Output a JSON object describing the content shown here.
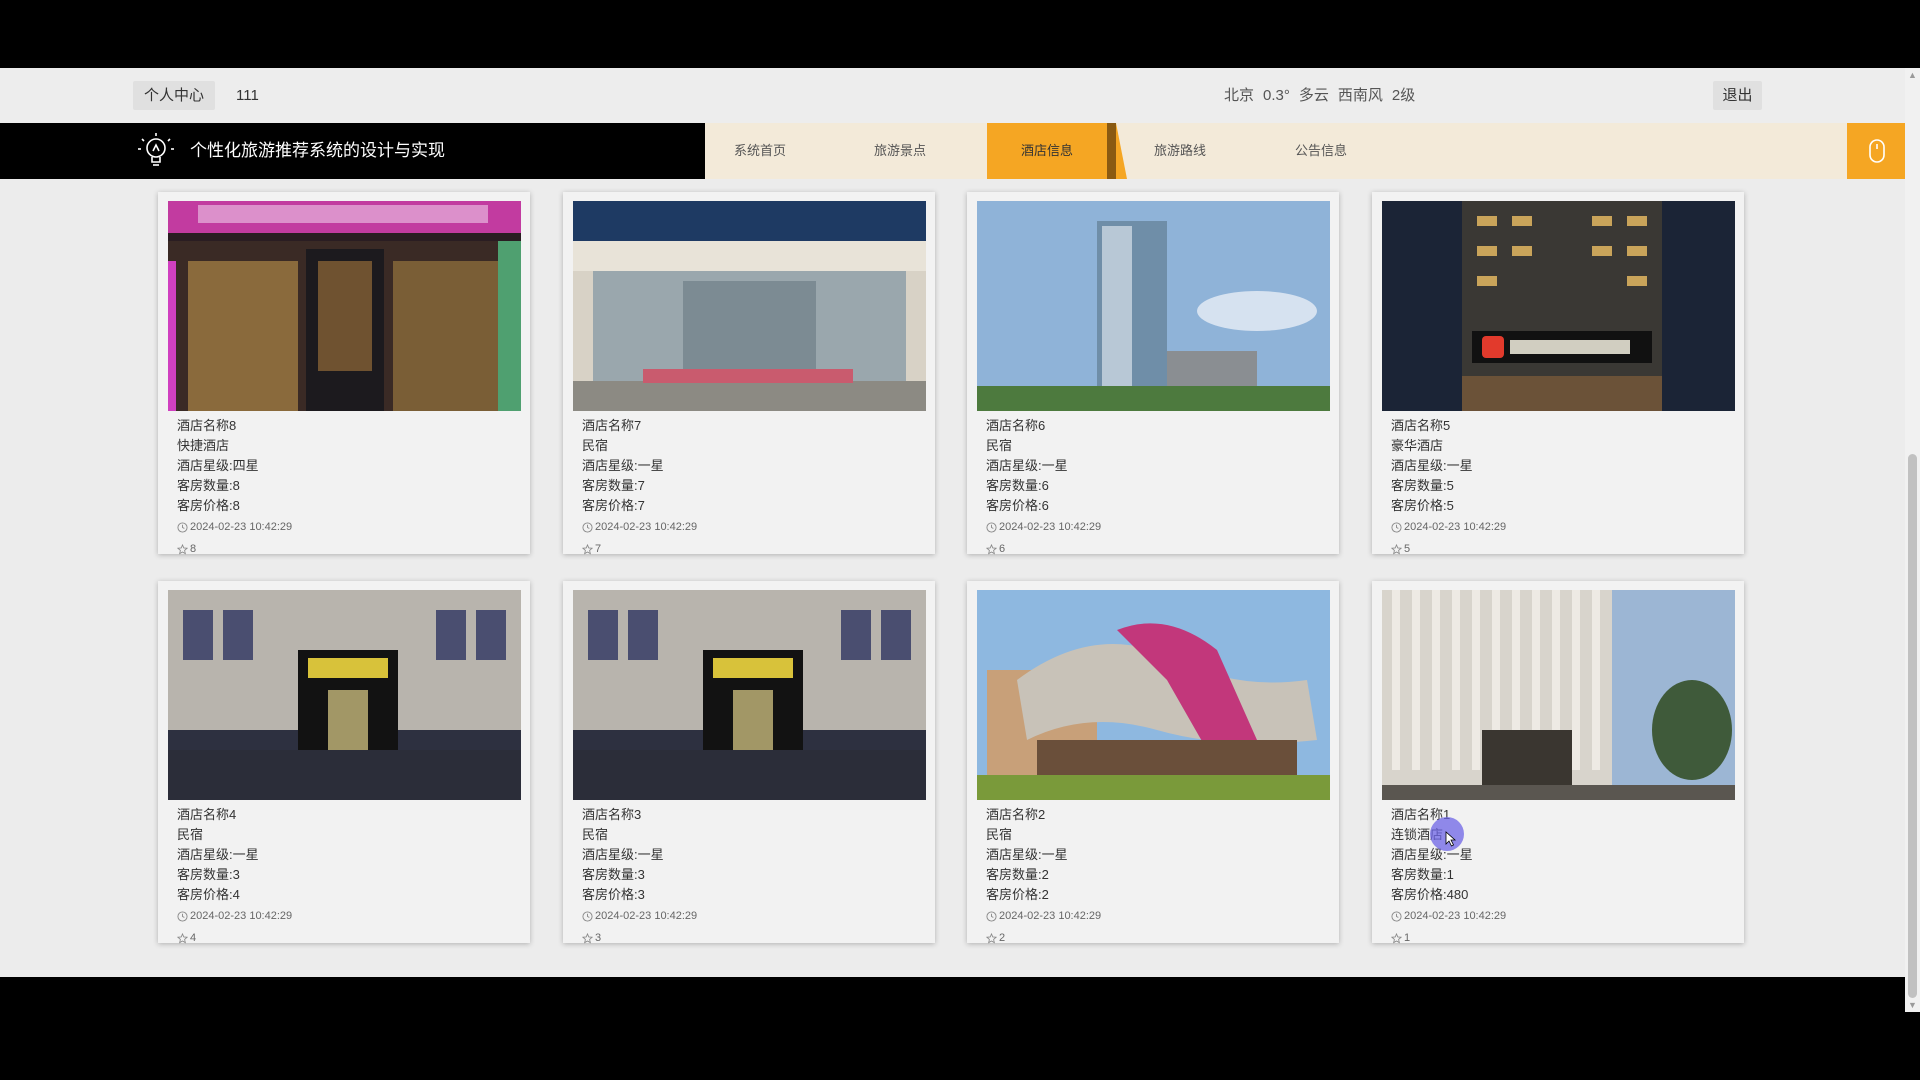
{
  "topbar": {
    "user_center": "个人中心",
    "username": "111",
    "weather": {
      "city": "北京",
      "temp": "0.3°",
      "condition": "多云",
      "wind_dir": "西南风",
      "wind_level": "2级"
    },
    "logout": "退出"
  },
  "brand": {
    "title": "个性化旅游推荐系统的设计与实现",
    "icon": "lightbulb-icon"
  },
  "nav": {
    "items": [
      {
        "label": "系统首页"
      },
      {
        "label": "旅游景点"
      },
      {
        "label": "酒店信息",
        "active": true
      },
      {
        "label": "旅游路线"
      },
      {
        "label": "公告信息"
      }
    ],
    "right_icon": "mouse-icon"
  },
  "hotels": [
    {
      "name": "酒店名称8",
      "type": "快捷酒店",
      "star": "酒店星级:四星",
      "rooms": "客房数量:8",
      "price": "客房价格:8",
      "time": "2024-02-23 10:42:29",
      "likes": "8",
      "image": "lavande-hotel-entrance"
    },
    {
      "name": "酒店名称7",
      "type": "民宿",
      "star": "酒店星级:一星",
      "rooms": "客房数量:7",
      "price": "客房价格:7",
      "time": "2024-02-23 10:42:29",
      "likes": "7",
      "image": "mercure-hotel-entrance"
    },
    {
      "name": "酒店名称6",
      "type": "民宿",
      "star": "酒店星级:一星",
      "rooms": "客房数量:6",
      "price": "客房价格:6",
      "time": "2024-02-23 10:42:29",
      "likes": "6",
      "image": "glass-tower"
    },
    {
      "name": "酒店名称5",
      "type": "豪华酒店",
      "star": "酒店星级:一星",
      "rooms": "客房数量:5",
      "price": "客房价格:5",
      "time": "2024-02-23 10:42:29",
      "likes": "5",
      "image": "super8-hotel-night"
    },
    {
      "name": "酒店名称4",
      "type": "民宿",
      "star": "酒店星级:一星",
      "rooms": "客房数量:3",
      "price": "客房价格:4",
      "time": "2024-02-23 10:42:29",
      "likes": "4",
      "image": "night-hotel-facade"
    },
    {
      "name": "酒店名称3",
      "type": "民宿",
      "star": "酒店星级:一星",
      "rooms": "客房数量:3",
      "price": "客房价格:3",
      "time": "2024-02-23 10:42:29",
      "likes": "3",
      "image": "night-hotel-facade"
    },
    {
      "name": "酒店名称2",
      "type": "民宿",
      "star": "酒店星级:一星",
      "rooms": "客房数量:2",
      "price": "客房价格:2",
      "time": "2024-02-23 10:42:29",
      "likes": "2",
      "image": "ribbon-roof-hotel"
    },
    {
      "name": "酒店名称1",
      "type": "连锁酒店",
      "star": "酒店星级:一星",
      "rooms": "客房数量:1",
      "price": "客房价格:480",
      "time": "2024-02-23 10:42:29",
      "likes": "1",
      "image": "white-louvre-hotel"
    }
  ],
  "colors": {
    "accent": "#f5a623",
    "nav_bg": "#f3ead9",
    "brand_bg": "#000000",
    "page_bg": "#ececec"
  }
}
